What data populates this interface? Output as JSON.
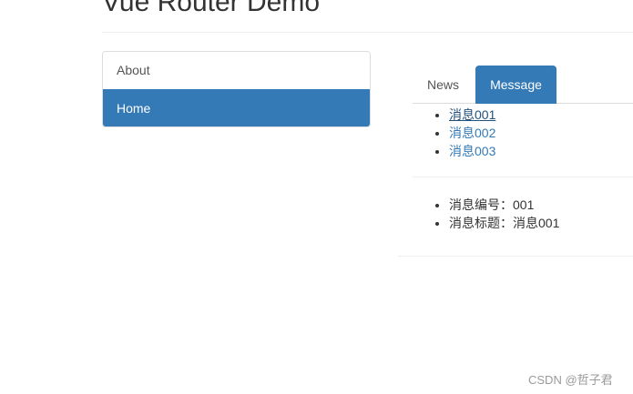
{
  "header": {
    "title": "Vue Router Demo"
  },
  "sidebar": {
    "items": [
      {
        "label": "About",
        "active": false
      },
      {
        "label": "Home",
        "active": true
      }
    ]
  },
  "tabs": [
    {
      "label": "News",
      "active": false
    },
    {
      "label": "Message",
      "active": true
    }
  ],
  "messages": [
    {
      "label": "消息001"
    },
    {
      "label": "消息002"
    },
    {
      "label": "消息003"
    }
  ],
  "detail": {
    "id_line": "消息编号：001",
    "title_line": "消息标题：消息001"
  },
  "watermark": "CSDN @哲子君",
  "colors": {
    "accent": "#337ab7",
    "link": "#337ab7",
    "link_hover": "#23527c",
    "border": "#dddddd"
  }
}
